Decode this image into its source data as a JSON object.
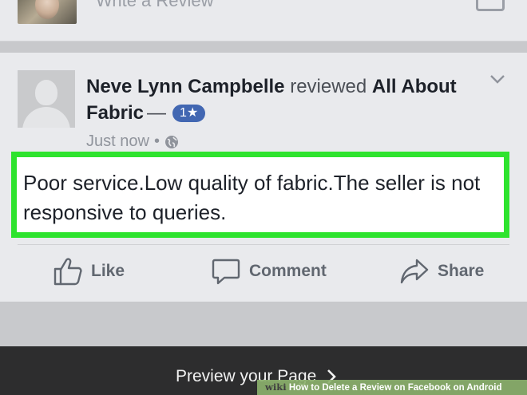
{
  "top_section": {
    "write_review_placeholder": "Write a Review",
    "photo_icon": "photo-icon"
  },
  "review": {
    "reviewer_name": "Neve Lynn Campbelle",
    "verb": "reviewed",
    "page_name": "All About Fabric",
    "separator": "—",
    "rating": "1",
    "rating_icon": "star-icon",
    "timestamp": "Just now",
    "dot": "•",
    "privacy_icon": "globe-icon",
    "menu_icon": "chevron-down-icon",
    "body": "Poor service.Low quality of fabric.The seller is not responsive to queries.",
    "highlight_color": "#2ee32e"
  },
  "actions": {
    "like_label": "Like",
    "comment_label": "Comment",
    "share_label": "Share"
  },
  "bottom_bar": {
    "preview_label": "Preview your Page"
  },
  "caption": {
    "brand": "wiki",
    "text": "How to Delete a Review on Facebook on Android"
  },
  "colors": {
    "facebook_blue": "#4267b2",
    "card_background": "#e9eaed",
    "bottom_bar": "#2d2d2e"
  }
}
